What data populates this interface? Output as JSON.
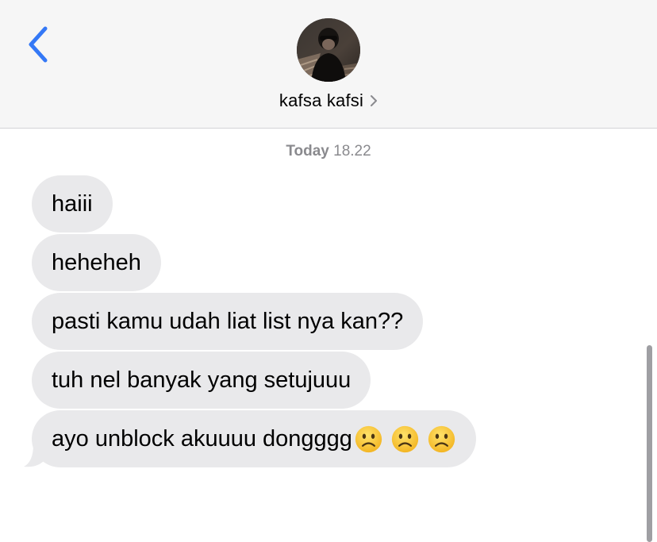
{
  "header": {
    "back_icon": "chevron-left-icon",
    "contact_name": "kafsa kafsi",
    "chevron_icon": "chevron-right-icon",
    "accent_color": "#3478f6"
  },
  "conversation": {
    "timestamp_day": "Today",
    "timestamp_time": "18.22",
    "messages": [
      {
        "text": "haiii"
      },
      {
        "text": "heheheh"
      },
      {
        "text": "pasti kamu udah liat list nya kan??"
      },
      {
        "text": "tuh nel banyak yang setujuuu"
      },
      {
        "text": "ayo unblock akuuuu dongggg",
        "emojis": [
          "slightly-frowning-face",
          "slightly-frowning-face",
          "slightly-frowning-face"
        ]
      }
    ]
  },
  "colors": {
    "header_background": "#f6f6f6",
    "incoming_bubble": "#e9e9eb",
    "timestamp_text": "#8a8a8e"
  }
}
